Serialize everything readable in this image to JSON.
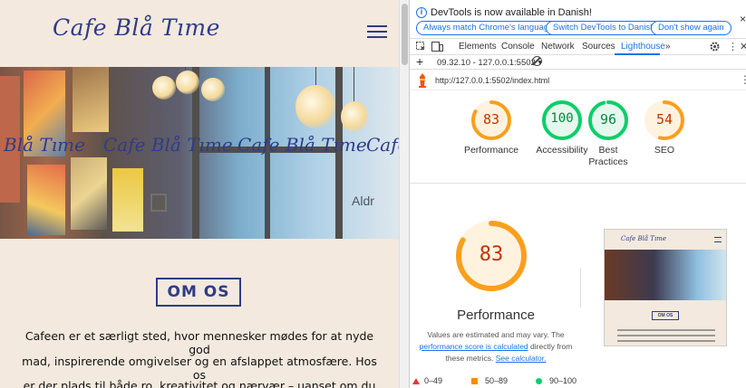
{
  "site": {
    "logo": "Cafe Blå Tıme",
    "hero_watermarks": [
      "Blå Tıme",
      "Cafe Blå Tıme",
      "Cafe Blå Tıme",
      "Cafe"
    ],
    "hero_text": "Aldr",
    "about_button": "OM OS",
    "paragraph_lines": [
      "Cafeen er et særligt sted, hvor mennesker mødes for at nyde god",
      "mad, inspirerende omgivelser og en afslappet atmosfære. Hos os",
      "er der plads til både ro, kreativitet og nærvær – uanset om du"
    ]
  },
  "devtools": {
    "info_bar": {
      "text": "DevTools is now available in Danish!",
      "buttons": [
        "Always match Chrome's language",
        "Switch DevTools to Danish",
        "Don't show again"
      ],
      "close_icon": "×"
    },
    "tabs": [
      "Elements",
      "Console",
      "Network",
      "Sources",
      "Lighthouse"
    ],
    "more_tabs": "»",
    "active_tab": "Lighthouse",
    "toolbar": {
      "add_icon": "+",
      "report_selector": "09.32.10 - 127.0.0.1:5502 ▾"
    },
    "url": "http://127.0.0.1:5502/index.html",
    "url_menu_icon": "⋮",
    "categories": [
      {
        "name": "Performance",
        "score": 83,
        "color": "#fa9f1c",
        "track": "#fff3e0"
      },
      {
        "name": "Accessibility",
        "score": 100,
        "color": "#0cce6b",
        "track": "#e6f8ee"
      },
      {
        "name": "Best Practices",
        "score": 96,
        "color": "#0cce6b",
        "track": "#e6f8ee"
      },
      {
        "name": "SEO",
        "score": 54,
        "color": "#fa9f1c",
        "track": "#fff3e0"
      }
    ],
    "main_gauge": {
      "label": "Performance",
      "score": 83,
      "color": "#fa9f1c",
      "track": "#fff3e0"
    },
    "disclaimer": {
      "before": "Values are estimated and may vary. The",
      "link1": "performance score is calculated",
      "middle": "directly from these metrics.",
      "link2": "See calculator."
    },
    "thumbnail": {
      "logo": "Cafe Blå Tıme",
      "button": "OM OS"
    },
    "legend": {
      "fail": "0–49",
      "average": "50–89",
      "pass": "90–100"
    }
  }
}
